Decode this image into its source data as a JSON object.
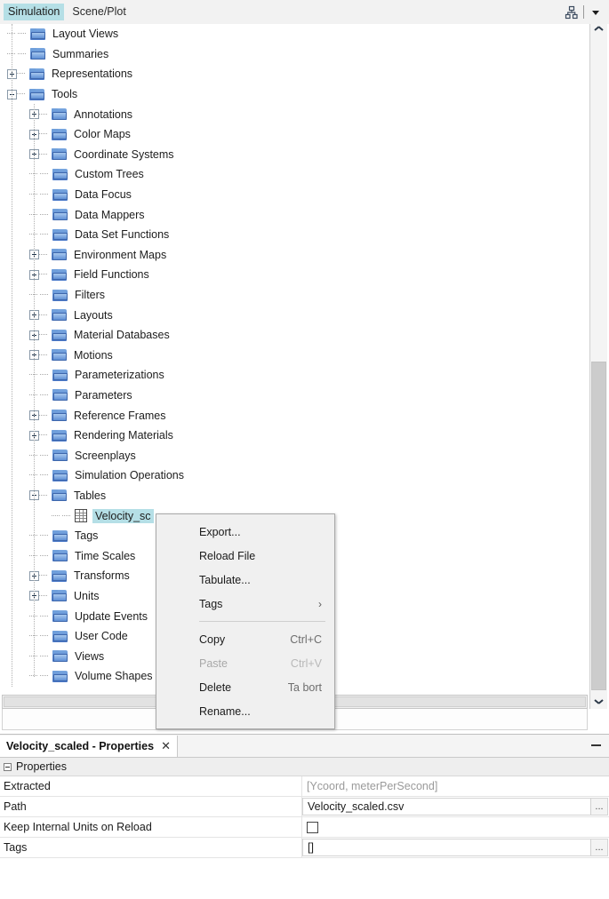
{
  "tabs": [
    {
      "label": "Simulation",
      "active": true
    },
    {
      "label": "Scene/Plot",
      "active": false
    }
  ],
  "toolbar": {
    "tree_icon": "object-tree-icon",
    "dropdown_icon": "chevron-down-icon"
  },
  "tree": {
    "items": [
      {
        "label": "Layout Views",
        "depth": 1,
        "handle": "none",
        "icon": "folder-icon"
      },
      {
        "label": "Summaries",
        "depth": 1,
        "handle": "none",
        "icon": "folder-icon"
      },
      {
        "label": "Representations",
        "depth": 1,
        "handle": "plus",
        "icon": "folder-icon"
      },
      {
        "label": "Tools",
        "depth": 1,
        "handle": "minus",
        "icon": "folder-icon"
      },
      {
        "label": "Annotations",
        "depth": 2,
        "handle": "plus",
        "icon": "folder-icon"
      },
      {
        "label": "Color Maps",
        "depth": 2,
        "handle": "plus",
        "icon": "folder-icon"
      },
      {
        "label": "Coordinate Systems",
        "depth": 2,
        "handle": "plus",
        "icon": "folder-icon"
      },
      {
        "label": "Custom Trees",
        "depth": 2,
        "handle": "none",
        "icon": "folder-icon"
      },
      {
        "label": "Data Focus",
        "depth": 2,
        "handle": "none",
        "icon": "folder-icon"
      },
      {
        "label": "Data Mappers",
        "depth": 2,
        "handle": "none",
        "icon": "folder-icon"
      },
      {
        "label": "Data Set Functions",
        "depth": 2,
        "handle": "none",
        "icon": "folder-icon"
      },
      {
        "label": "Environment Maps",
        "depth": 2,
        "handle": "plus",
        "icon": "folder-icon"
      },
      {
        "label": "Field Functions",
        "depth": 2,
        "handle": "plus",
        "icon": "folder-icon"
      },
      {
        "label": "Filters",
        "depth": 2,
        "handle": "none",
        "icon": "folder-icon"
      },
      {
        "label": "Layouts",
        "depth": 2,
        "handle": "plus",
        "icon": "folder-icon"
      },
      {
        "label": "Material Databases",
        "depth": 2,
        "handle": "plus",
        "icon": "folder-icon"
      },
      {
        "label": "Motions",
        "depth": 2,
        "handle": "plus",
        "icon": "folder-icon"
      },
      {
        "label": "Parameterizations",
        "depth": 2,
        "handle": "none",
        "icon": "folder-icon"
      },
      {
        "label": "Parameters",
        "depth": 2,
        "handle": "none",
        "icon": "folder-icon"
      },
      {
        "label": "Reference Frames",
        "depth": 2,
        "handle": "plus",
        "icon": "folder-icon"
      },
      {
        "label": "Rendering Materials",
        "depth": 2,
        "handle": "plus",
        "icon": "folder-icon"
      },
      {
        "label": "Screenplays",
        "depth": 2,
        "handle": "none",
        "icon": "folder-icon"
      },
      {
        "label": "Simulation Operations",
        "depth": 2,
        "handle": "none",
        "icon": "folder-icon"
      },
      {
        "label": "Tables",
        "depth": 2,
        "handle": "minus",
        "icon": "folder-icon"
      },
      {
        "label": "Velocity_sc",
        "depth": 3,
        "handle": "none",
        "icon": "table-icon",
        "selected": true
      },
      {
        "label": "Tags",
        "depth": 2,
        "handle": "none",
        "icon": "folder-icon"
      },
      {
        "label": "Time Scales",
        "depth": 2,
        "handle": "none",
        "icon": "folder-icon"
      },
      {
        "label": "Transforms",
        "depth": 2,
        "handle": "plus",
        "icon": "folder-icon"
      },
      {
        "label": "Units",
        "depth": 2,
        "handle": "plus",
        "icon": "folder-icon"
      },
      {
        "label": "Update Events",
        "depth": 2,
        "handle": "none",
        "icon": "folder-icon"
      },
      {
        "label": "User Code",
        "depth": 2,
        "handle": "none",
        "icon": "folder-icon"
      },
      {
        "label": "Views",
        "depth": 2,
        "handle": "none",
        "icon": "folder-icon"
      },
      {
        "label": "Volume Shapes",
        "depth": 2,
        "handle": "none",
        "icon": "folder-icon"
      }
    ]
  },
  "context_menu": {
    "items": [
      {
        "label": "Export...",
        "accel": "",
        "disabled": false,
        "submenu": false
      },
      {
        "label": "Reload File",
        "accel": "",
        "disabled": false,
        "submenu": false
      },
      {
        "label": "Tabulate...",
        "accel": "",
        "disabled": false,
        "submenu": false
      },
      {
        "label": "Tags",
        "accel": "",
        "disabled": false,
        "submenu": true
      },
      {
        "separator": true
      },
      {
        "label": "Copy",
        "accel": "Ctrl+C",
        "disabled": false,
        "submenu": false
      },
      {
        "label": "Paste",
        "accel": "Ctrl+V",
        "disabled": true,
        "submenu": false
      },
      {
        "label": "Delete",
        "accel": "Ta bort",
        "disabled": false,
        "submenu": false
      },
      {
        "label": "Rename...",
        "accel": "",
        "disabled": false,
        "submenu": false
      }
    ],
    "submenu_arrow": "chevron-right-icon"
  },
  "properties": {
    "tab_title": "Velocity_scaled - Properties",
    "close_label": "✕",
    "minimize_label": "minimize-icon",
    "group_label": "Properties",
    "rows": [
      {
        "name": "Extracted",
        "value": "[Ycoord, meterPerSecond]",
        "type": "readonly"
      },
      {
        "name": "Path",
        "value": "Velocity_scaled.csv",
        "type": "text-ellipsis",
        "ellipsis": "..."
      },
      {
        "name": "Keep Internal Units on Reload",
        "value": "",
        "type": "checkbox",
        "checked": false
      },
      {
        "name": "Tags",
        "value": "[]",
        "type": "text-ellipsis",
        "ellipsis": "..."
      }
    ]
  },
  "colors": {
    "selection": "#b5dfe6",
    "folder": "#5f8fd4",
    "panel_bg": "#f4f4f4"
  }
}
